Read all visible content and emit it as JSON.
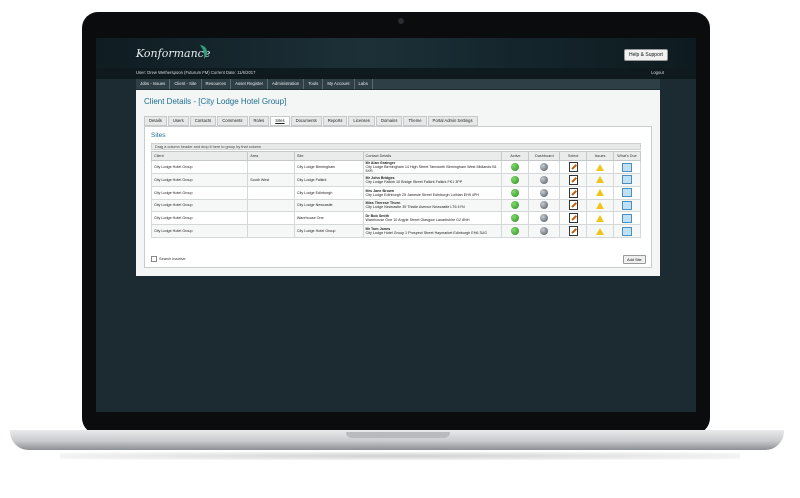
{
  "app": {
    "logo": "Konformance",
    "help_button": "Help & Support",
    "user_line": "User: Drew Wetherspoon (Futurum FM)     Current Date: 11/6/2017",
    "logout": "Logout"
  },
  "menu": [
    "Jobs - Issues",
    "Client - Site",
    "Resources",
    "Asset Register",
    "Administration",
    "Tools",
    "My Account",
    "Labs"
  ],
  "page": {
    "title": "Client Details - [City Lodge Hotel Group]",
    "tabs": [
      "Details",
      "Users",
      "Contacts",
      "Comments",
      "Roles",
      "Sites",
      "Documents",
      "Reports",
      "Licenses",
      "Domains",
      "Theme",
      "Portal Admin Settings"
    ],
    "active_tab": "Sites"
  },
  "sites": {
    "title": "Sites",
    "group_hint": "Drag a column header and drop it here to group by that column",
    "columns": [
      "Client",
      "Area",
      "Site",
      "Contact Details",
      "Active",
      "Dashboard",
      "Select",
      "Issues",
      "What's Due"
    ],
    "rows": [
      {
        "client": "City Lodge Hotel Group",
        "area": "",
        "site": "City Lodge Birmingham",
        "contact_name": "Mr Alan Grainger",
        "contact_detail": "City Lodge Birmingham 14 High Street Tamworth Birmingham West Midlands B1 5XR"
      },
      {
        "client": "City Lodge Hotel Group",
        "area": "South West",
        "site": "City Lodge Falkirk",
        "contact_name": "Mr John Bridges",
        "contact_detail": "City Lodge Falkirk 10 Bridge Street Falkirk Falkirk FK1 3PP"
      },
      {
        "client": "City Lodge Hotel Group",
        "area": "",
        "site": "City Lodge Edinburgh",
        "contact_name": "Mrs Jane Brown",
        "contact_detail": "City Lodge Edinburgh 25 Jamesie Street Edinburgh Lothian EH9 4PH"
      },
      {
        "client": "City Lodge Hotel Group",
        "area": "",
        "site": "City Lodge Newcastle",
        "contact_name": "Miss Therese Thorn",
        "contact_detail": "City Lodge Newcastle 39 Thistle Avenue Newcastle LT6 4YN"
      },
      {
        "client": "City Lodge Hotel Group",
        "area": "",
        "site": "Warehouse One",
        "contact_name": "Dr Bob Smith",
        "contact_detail": "Warehouse One 10 Argyle Street Glasgow Lanarkshire G2 8NH"
      },
      {
        "client": "City Lodge Hotel Group",
        "area": "",
        "site": "City Lodge Hotel Group",
        "contact_name": "Mr Tom Jones",
        "contact_detail": "City Lodge Hotel Group 1 Prospect Street Haymarket Edinburgh EH6 3UG"
      }
    ],
    "search_inactive": "Search inactive",
    "add_site": "Add Site"
  },
  "colors": {
    "accent": "#1d6f8f",
    "header_dark": "#0f1c22",
    "menu_bar": "#2f3f46",
    "active_green": "#2f8a20",
    "warning_yellow": "#f0c419"
  },
  "icons": {
    "active": "green-circle-icon",
    "dashboard": "dashboard-icon",
    "select": "edit-icon",
    "issues": "warning-icon",
    "whats_due": "calendar-icon"
  }
}
